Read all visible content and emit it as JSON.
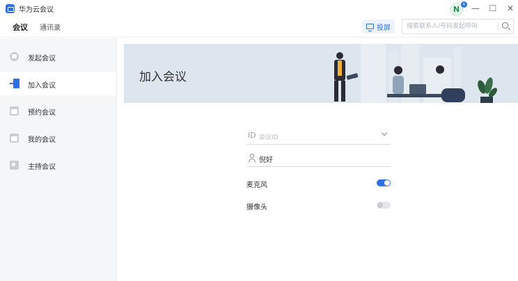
{
  "app": {
    "title": "华为云会议",
    "avatar_letter": "N",
    "avatar_badge": "6"
  },
  "window_controls": {
    "minimize": "—",
    "maximize": "☐",
    "close": "✕"
  },
  "nav": {
    "tabs": [
      {
        "label": "会议",
        "active": true
      },
      {
        "label": "通讯录",
        "active": false
      }
    ]
  },
  "toolbar": {
    "cast_label": "投屏",
    "search_placeholder": "搜索联系人/号码发起呼叫"
  },
  "sidebar": {
    "items": [
      {
        "label": "发起会议",
        "icon": "start-meeting-icon",
        "active": false
      },
      {
        "label": "加入会议",
        "icon": "join-meeting-icon",
        "active": true
      },
      {
        "label": "预约会议",
        "icon": "schedule-meeting-icon",
        "active": false
      },
      {
        "label": "我的会议",
        "icon": "my-meetings-icon",
        "active": false
      },
      {
        "label": "主持会议",
        "icon": "host-meeting-icon",
        "active": false
      }
    ]
  },
  "main": {
    "title": "加入会议",
    "form": {
      "id_prefix": "ID",
      "id_placeholder": "会议ID",
      "name_value": "倪好",
      "microphone_label": "麦克风",
      "microphone_on": true,
      "camera_label": "摄像头",
      "camera_on": false
    }
  },
  "colors": {
    "accent": "#2f6fe8",
    "sidebar_bg": "#f5f6f8",
    "banner_bg": "#dde6ee"
  }
}
